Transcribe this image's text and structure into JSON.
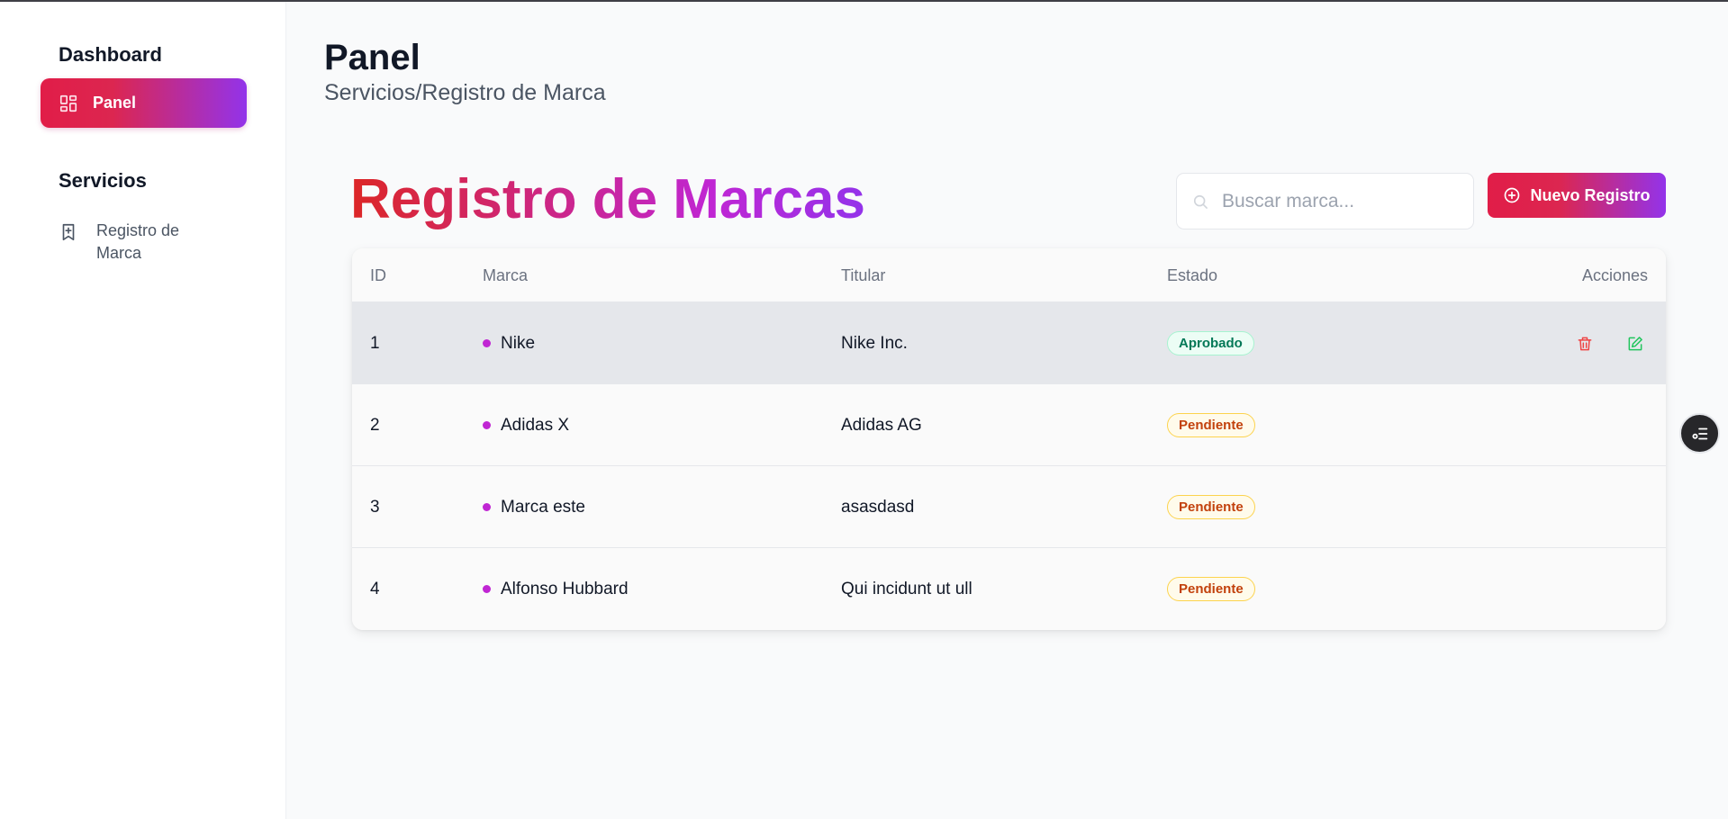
{
  "sidebar": {
    "dashboard_title": "Dashboard",
    "active_item": {
      "label": "Panel",
      "icon": "grid-icon"
    },
    "services_title": "Servicios",
    "items": [
      {
        "label": "Registro de Marca",
        "icon": "bookmark-plus-icon"
      }
    ]
  },
  "header": {
    "title": "Panel",
    "breadcrumb": "Servicios/Registro de Marca"
  },
  "main": {
    "title": "Registro de Marcas",
    "search": {
      "placeholder": "Buscar marca...",
      "value": ""
    },
    "new_button_label": "Nuevo Registro",
    "table": {
      "columns": [
        "ID",
        "Marca",
        "Titular",
        "Estado",
        "Acciones"
      ],
      "rows": [
        {
          "id": "1",
          "marca": "Nike",
          "titular": "Nike Inc.",
          "estado": "Aprobado",
          "status": "ok"
        },
        {
          "id": "2",
          "marca": "Adidas X",
          "titular": "Adidas AG",
          "estado": "Pendiente",
          "status": "pending"
        },
        {
          "id": "3",
          "marca": "Marca este",
          "titular": "asasdasd",
          "estado": "Pendiente",
          "status": "pending"
        },
        {
          "id": "4",
          "marca": "Alfonso Hubbard",
          "titular": "Qui incidunt ut ull",
          "estado": "Pendiente",
          "status": "pending"
        }
      ]
    }
  },
  "colors": {
    "accent_start": "#e11d48",
    "accent_end": "#9333ea",
    "approved": "#047857",
    "pending": "#c2410c"
  }
}
